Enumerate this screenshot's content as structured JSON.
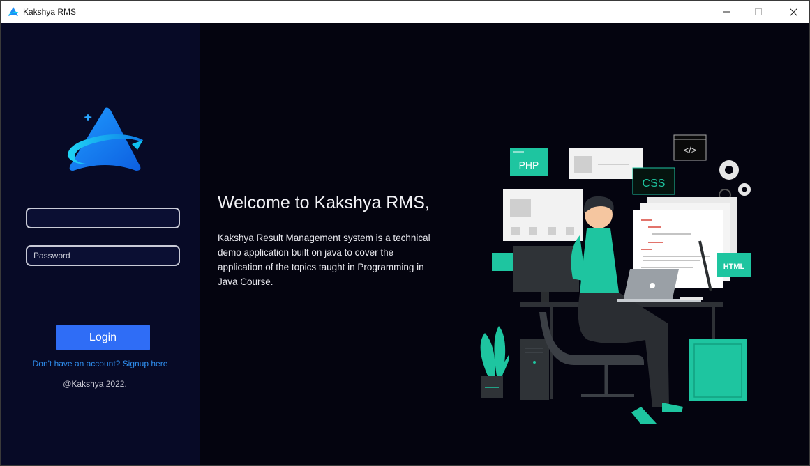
{
  "window": {
    "title": "Kakshya RMS",
    "controls": {
      "minimize_icon": "minimize-icon",
      "maximize_icon": "maximize-icon",
      "close_icon": "close-icon"
    }
  },
  "sidebar": {
    "logo_icon": "kakshya-logo-icon",
    "username": {
      "value": "",
      "placeholder": ""
    },
    "password": {
      "value": "",
      "placeholder": "Password"
    },
    "login_label": "Login",
    "signup_link": "Don't have an account? Signup here",
    "copyright": "@Kakshya 2022."
  },
  "main": {
    "welcome_title": "Welcome to Kakshya RMS,",
    "welcome_description": "Kakshya Result Management system is a technical demo application built on java to cover the application of the topics taught in Programming in Java Course.",
    "illustration": {
      "labels": {
        "php": "PHP",
        "css": "CSS",
        "html": "HTML",
        "code": "</>"
      }
    }
  },
  "colors": {
    "sidebar_bg": "#070a26",
    "main_bg": "#04040f",
    "accent_blue": "#2f6df6",
    "link_blue": "#2f8ff0",
    "teal": "#1ec5a0"
  }
}
